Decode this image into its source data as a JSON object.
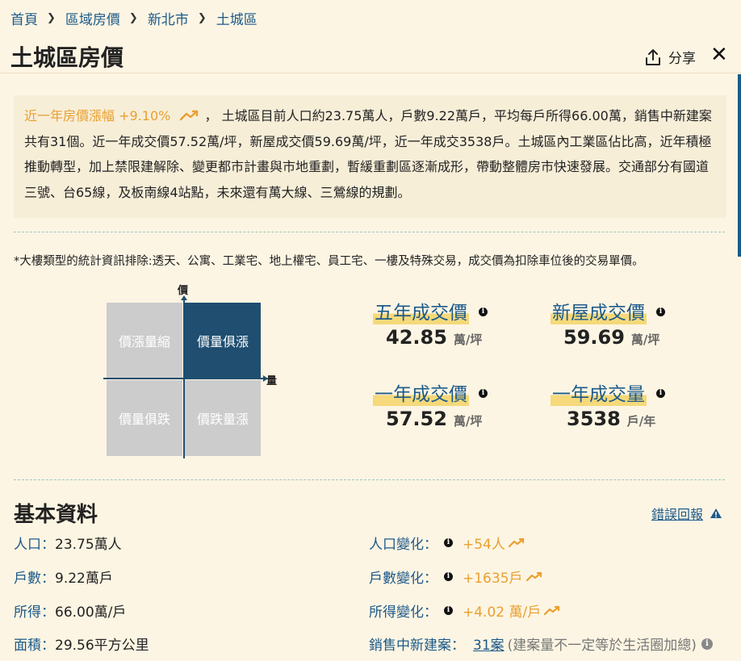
{
  "breadcrumb": {
    "items": [
      "首頁",
      "區域房價",
      "新北市",
      "土城區"
    ]
  },
  "header": {
    "title": "土城區房價",
    "share_label": "分享"
  },
  "intro": {
    "growth_text": "近一年房價漲幅 +9.10%",
    "text": " ， 土城區目前人口約23.75萬人，戶數9.22萬戶，平均每戶所得66.00萬，銷售中新建案共有31個。近一年成交價57.52萬/坪，新屋成交價59.69萬/坪，近一年成交3538戶。土城區內工業區佔比高，近年積極推動轉型，加上禁限建解除、變更都市計畫與市地重劃，暫緩重劃區逐漸成形，帶動整體房市快速發展。交通部分有國道三號、台65線，及板南線4站點，未來還有萬大線、三鶯線的規劃。"
  },
  "note": "*大樓類型的統計資訊排除:透天、公寓、工業宅、地上權宅、員工宅、一樓及特殊交易，成交價為扣除車位後的交易單價。",
  "quadrant": {
    "y_axis": "價",
    "x_axis": "量",
    "top_left": "價漲量縮",
    "top_right": "價量俱漲",
    "bottom_left": "價量俱跌",
    "bottom_right": "價跌量漲",
    "active": "top_right"
  },
  "stats": [
    {
      "label": "五年成交價",
      "value": "42.85",
      "unit": "萬/坪"
    },
    {
      "label": "新屋成交價",
      "value": "59.69",
      "unit": "萬/坪"
    },
    {
      "label": "一年成交價",
      "value": "57.52",
      "unit": "萬/坪"
    },
    {
      "label": "一年成交量",
      "value": "3538",
      "unit": "戶/年"
    }
  ],
  "basic": {
    "title": "基本資料",
    "report_label": "錯誤回報",
    "left": [
      {
        "key": "人口：",
        "value": "23.75萬人"
      },
      {
        "key": "戶數：",
        "value": "9.22萬戶"
      },
      {
        "key": "所得：",
        "value": "66.00萬/戶"
      },
      {
        "key": "面積：",
        "value": "29.56平方公里"
      }
    ],
    "right": [
      {
        "key": "人口變化：",
        "value": "+54人"
      },
      {
        "key": "戶數變化：",
        "value": "+1635戶"
      },
      {
        "key": "所得變化：",
        "value": "+4.02 萬/戶"
      }
    ],
    "sales": {
      "key": "銷售中新建案：",
      "link": "31案",
      "note": "(建案量不一定等於生活圈加總)"
    }
  },
  "colors": {
    "accent": "#1c5a8a",
    "growth": "#e8a030",
    "active_quadrant": "#1f4e70",
    "background": "#fdf5e3"
  }
}
